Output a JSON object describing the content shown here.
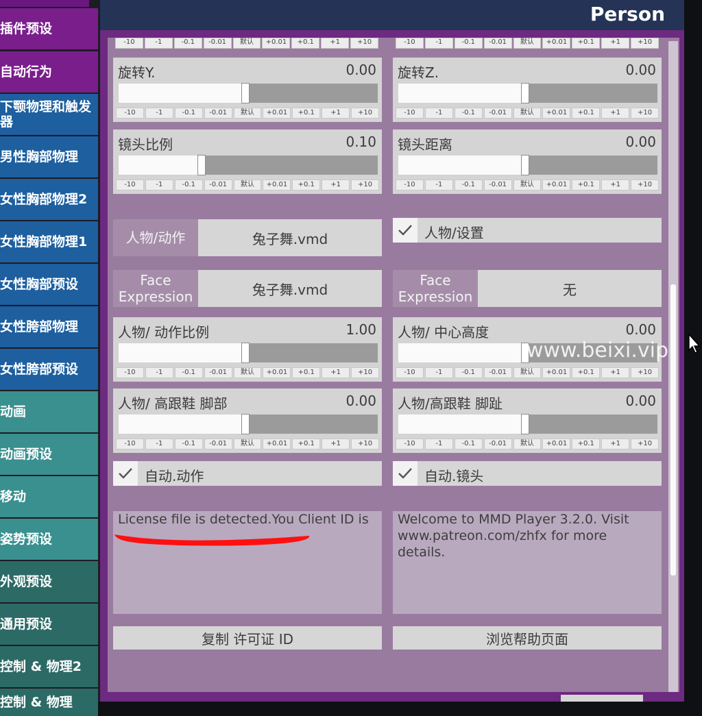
{
  "header": {
    "title": "Person"
  },
  "sidebar": {
    "items": [
      {
        "label": "插件预设",
        "color": "#7a1e8c"
      },
      {
        "label": "自动行为",
        "color": "#7a1e8c"
      },
      {
        "label": "下颚物理和触发器",
        "color": "#1d5f9f"
      },
      {
        "label": "男性胸部物理",
        "color": "#1d5f9f"
      },
      {
        "label": "女性胸部物理2",
        "color": "#1d5f9f"
      },
      {
        "label": "女性胸部物理1",
        "color": "#1d5f9f"
      },
      {
        "label": "女性胸部预设",
        "color": "#1d5f9f"
      },
      {
        "label": "女性胯部物理",
        "color": "#1d5f9f"
      },
      {
        "label": "女性胯部预设",
        "color": "#1d5f9f"
      },
      {
        "label": "动画",
        "color": "#3a8f8f"
      },
      {
        "label": "动画预设",
        "color": "#3a8f8f"
      },
      {
        "label": "移动",
        "color": "#3a8f8f"
      },
      {
        "label": "姿势预设",
        "color": "#3a8f8f"
      },
      {
        "label": "外观预设",
        "color": "#2c6a66"
      },
      {
        "label": "通用预设",
        "color": "#2c6a66"
      },
      {
        "label": "控制 & 物理2",
        "color": "#2c6a66"
      },
      {
        "label": "控制 & 物理",
        "color": "#2c6a66"
      }
    ]
  },
  "steps": [
    "-10",
    "-1",
    "-0.1",
    "-0.01",
    "默认",
    "+0.01",
    "+0.1",
    "+1",
    "+10"
  ],
  "sliders": [
    {
      "label": "旋转Y.",
      "value": "0.00",
      "fraction": 0.49
    },
    {
      "label": "旋转Z.",
      "value": "0.00",
      "fraction": 0.49
    },
    {
      "label": "镜头比例",
      "value": "0.10",
      "fraction": 0.32
    },
    {
      "label": "镜头距离",
      "value": "0.00",
      "fraction": 0.49
    },
    {
      "label": "人物/ 动作比例",
      "value": "1.00",
      "fraction": 0.49
    },
    {
      "label": "人物/ 中心高度",
      "value": "0.00",
      "fraction": 0.49
    },
    {
      "label": "人物/ 高跟鞋 脚部",
      "value": "0.00",
      "fraction": 0.49
    },
    {
      "label": "人物/高跟鞋 脚趾",
      "value": "0.00",
      "fraction": 0.49
    }
  ],
  "motion": {
    "label": "人物/动作",
    "file": "兔子舞.vmd"
  },
  "face_left": {
    "label": "Face Expression",
    "file": "兔子舞.vmd"
  },
  "face_right": {
    "label": "Face Expression",
    "file": "无"
  },
  "toggles": {
    "settings": {
      "label": "人物/设置",
      "checked": true
    },
    "auto_motion": {
      "label": "自动.动作",
      "checked": true
    },
    "auto_camera": {
      "label": "自动.镜头",
      "checked": true
    }
  },
  "license_text": "License file is detected.You Client ID is",
  "welcome_text": "Welcome to MMD Player 3.2.0. Visit www.patreon.com/zhfx for more details.",
  "buttons": {
    "copy_license": "复制 许可证 ID",
    "help": "浏览帮助页面"
  },
  "watermark": "www.beixi.vip",
  "colors": {
    "header": "#243356",
    "frame": "#6c2a80",
    "panel": "#9a7ba0"
  }
}
